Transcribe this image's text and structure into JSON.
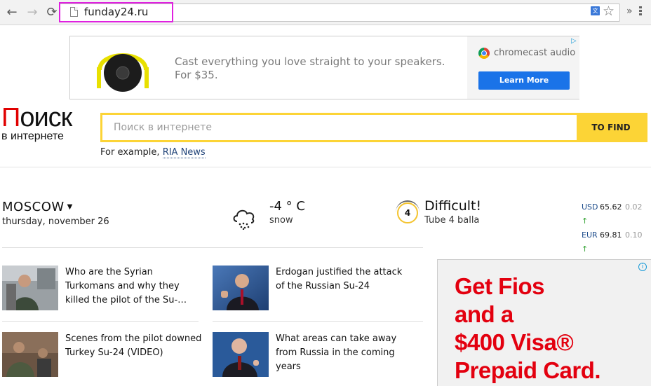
{
  "browser": {
    "url": "funday24.ru",
    "back_glyph": "←",
    "forward_glyph": "→",
    "reload_glyph": "⟳",
    "star_glyph": "☆",
    "overflow_glyph": "»"
  },
  "ad_top": {
    "text_line1": "Cast everything you love straight to your speakers.",
    "text_line2": "For $35.",
    "brand": "chromecast audio",
    "button": "Learn More",
    "adchoice_glyph": "▷"
  },
  "logo": {
    "first_letter": "П",
    "rest": "оиск",
    "subtitle": "в интернете"
  },
  "search": {
    "placeholder": "Поиск в интернете",
    "button": "TO FIND",
    "example_prefix": "For example,",
    "example_link": "RIA News"
  },
  "info": {
    "city": "MOSCOW",
    "date": "thursday, november 26",
    "temperature": "-4 ° C",
    "condition": "snow",
    "traffic_score": "4",
    "traffic_title": "Difficult!",
    "traffic_sub": "Tube 4 balla",
    "rates": [
      {
        "currency": "USD",
        "value": "65.62",
        "change": "0.02"
      },
      {
        "currency": "EUR",
        "value": "69.81",
        "change": "0.10"
      }
    ],
    "rate_up_glyph": "↑"
  },
  "news": [
    {
      "title": "Who are the Syrian Turkomans and why they killed the pilot of the Su-…"
    },
    {
      "title": "Erdogan justified the attack of the Russian Su-24"
    },
    {
      "title": "Scenes from the pilot downed Turkey Su-24 (VIDEO)"
    },
    {
      "title": "What areas can take away from Russia in the coming years"
    }
  ],
  "ad_right": {
    "line1": "Get Fios",
    "line2": "and a",
    "line3": "$400 Visa®",
    "line4": "Prepaid Card.",
    "info_glyph": "i"
  },
  "colors": {
    "accent_yellow": "#fcd436",
    "logo_red": "#e00000",
    "fios_red": "#e3000f",
    "link_blue": "#22457a",
    "url_highlight": "#e020e0"
  }
}
